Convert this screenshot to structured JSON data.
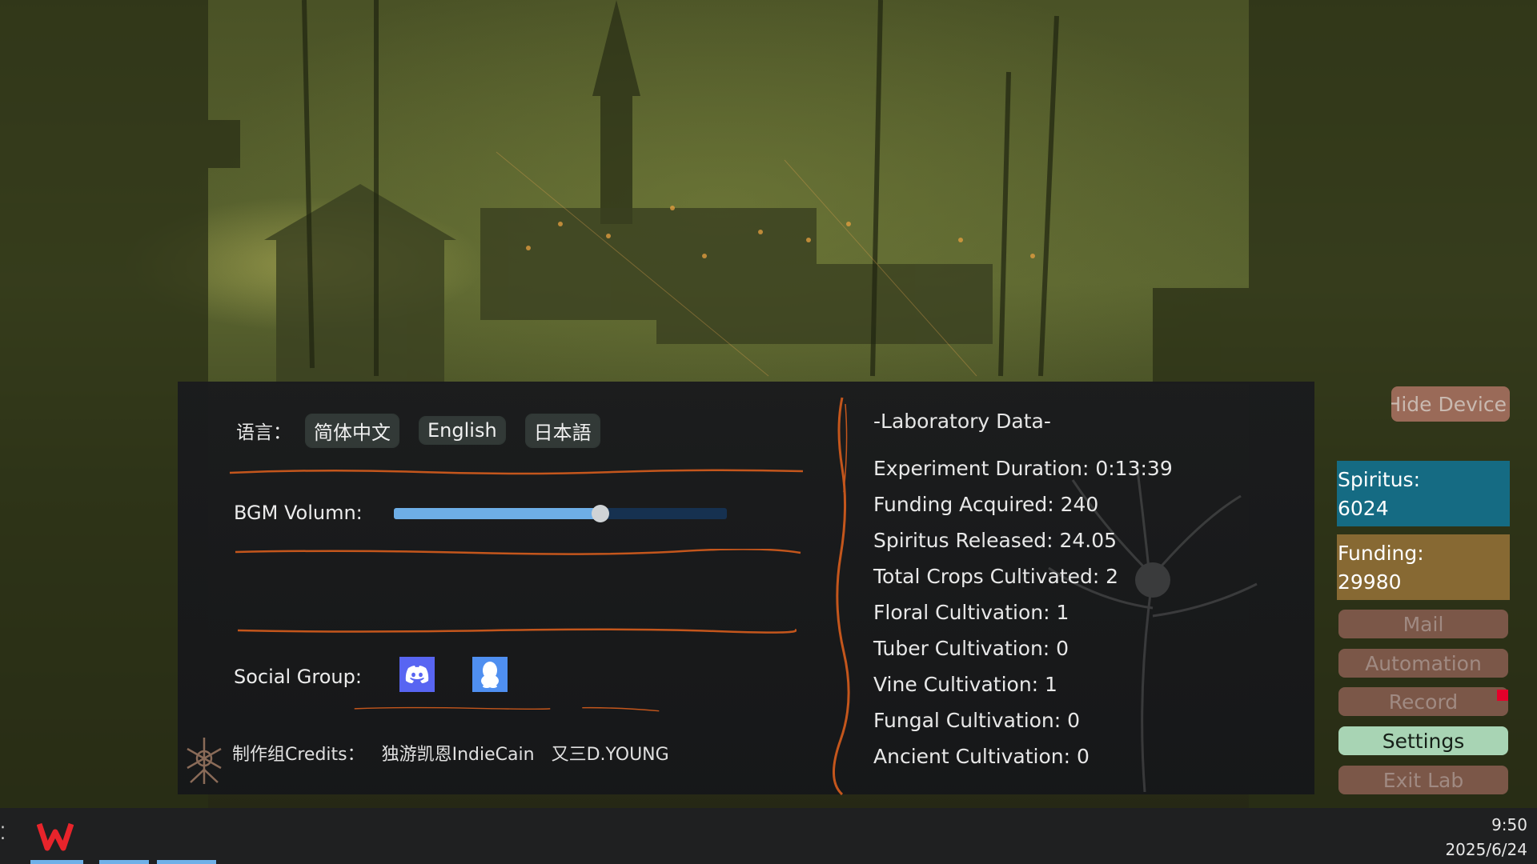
{
  "settings": {
    "language_label": "语言：",
    "languages": [
      "简体中文",
      "English",
      "日本語"
    ],
    "bgm_label": "BGM Volumn:",
    "bgm_volume": 0.62,
    "social_label": "Social Group:",
    "social_icons": [
      "discord-icon",
      "qq-icon"
    ],
    "credits_label": "制作组Credits：",
    "credits_names": [
      "独游凯恩IndieCain",
      "又三D.YOUNG"
    ]
  },
  "lab": {
    "title": "-Laboratory Data-",
    "items": [
      "Experiment Duration: 0:13:39",
      "Funding Acquired: 240",
      "Spiritus Released: 24.05",
      "Total Crops Cultivated: 2",
      "Floral Cultivation: 1",
      "Tuber Cultivation: 0",
      "Vine Cultivation: 1",
      "Fungal Cultivation: 0",
      "Ancient Cultivation: 0"
    ]
  },
  "sidebar": {
    "hide_label": "Hide Device",
    "spiritus_label": "Spiritus:",
    "spiritus_value": "6024",
    "funding_label": "Funding:",
    "funding_value": "29980",
    "buttons": [
      "Mail",
      "Automation",
      "Record",
      "Settings",
      "Exit Lab"
    ],
    "active": "Settings"
  },
  "taskbar": {
    "time": "9:50",
    "date": "2025/6/24"
  },
  "colors": {
    "accent_orange": "#c4561c",
    "spiritus_bg": "#156b83",
    "funding_bg": "#876933",
    "slider_fill": "#6eaee6",
    "active_button": "#a8d4b4"
  }
}
